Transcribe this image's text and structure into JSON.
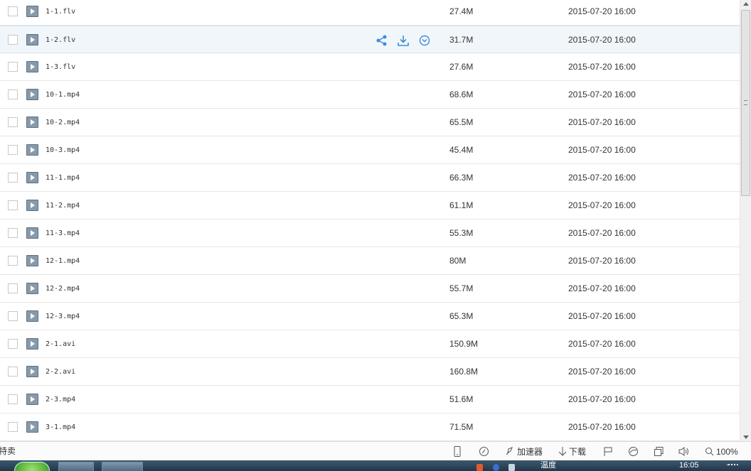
{
  "files": [
    {
      "name": "1-1.flv",
      "size": "27.4M",
      "date": "2015-07-20 16:00"
    },
    {
      "name": "1-2.flv",
      "size": "31.7M",
      "date": "2015-07-20 16:00",
      "hovered": true
    },
    {
      "name": "1-3.flv",
      "size": "27.6M",
      "date": "2015-07-20 16:00"
    },
    {
      "name": "10-1.mp4",
      "size": "68.6M",
      "date": "2015-07-20 16:00"
    },
    {
      "name": "10-2.mp4",
      "size": "65.5M",
      "date": "2015-07-20 16:00"
    },
    {
      "name": "10-3.mp4",
      "size": "45.4M",
      "date": "2015-07-20 16:00"
    },
    {
      "name": "11-1.mp4",
      "size": "66.3M",
      "date": "2015-07-20 16:00"
    },
    {
      "name": "11-2.mp4",
      "size": "61.1M",
      "date": "2015-07-20 16:00"
    },
    {
      "name": "11-3.mp4",
      "size": "55.3M",
      "date": "2015-07-20 16:00"
    },
    {
      "name": "12-1.mp4",
      "size": "80M",
      "date": "2015-07-20 16:00"
    },
    {
      "name": "12-2.mp4",
      "size": "55.7M",
      "date": "2015-07-20 16:00"
    },
    {
      "name": "12-3.mp4",
      "size": "65.3M",
      "date": "2015-07-20 16:00"
    },
    {
      "name": "2-1.avi",
      "size": "150.9M",
      "date": "2015-07-20 16:00"
    },
    {
      "name": "2-2.avi",
      "size": "160.8M",
      "date": "2015-07-20 16:00"
    },
    {
      "name": "2-3.mp4",
      "size": "51.6M",
      "date": "2015-07-20 16:00"
    },
    {
      "name": "3-1.mp4",
      "size": "71.5M",
      "date": "2015-07-20 16:00"
    }
  ],
  "row_actions": [
    "share-icon",
    "download-icon",
    "more-icon"
  ],
  "colors": {
    "accent": "#3b8fd6",
    "hover_row": "#f1f6fb",
    "file_icon": "#5b7084"
  },
  "status_bar": {
    "left_text": "特卖",
    "accelerator_label": "加速器",
    "download_label": "下载",
    "zoom": "100%"
  },
  "taskbar": {
    "tray_text": "温度",
    "clock": "16:05"
  }
}
